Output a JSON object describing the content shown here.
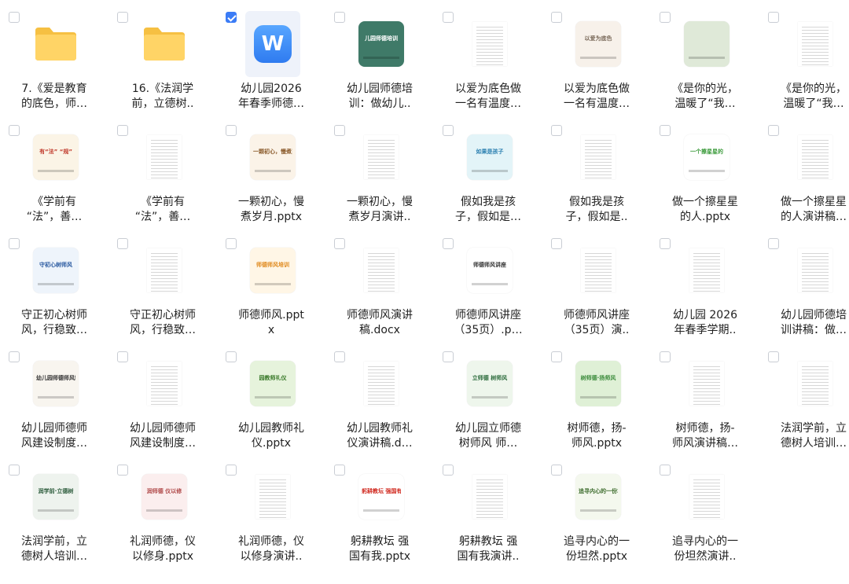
{
  "files": [
    {
      "kind": "folder",
      "line1": "7.《爱是教育",
      "line2": "的底色，师…",
      "selected": false
    },
    {
      "kind": "folder",
      "line1": "16.《法润学",
      "line2": "前，立德树..",
      "selected": false
    },
    {
      "kind": "wps",
      "glyph": "W",
      "line1": "幼儿园2026",
      "line2": "年春季师德…",
      "selected": true
    },
    {
      "kind": "slide",
      "bg": "#3f7a68",
      "fg": "#ffffff",
      "text": "儿园师德培训",
      "line1": "幼儿园师德培",
      "line2": "训：做幼儿..",
      "selected": false
    },
    {
      "kind": "doc",
      "line1": "以爱为底色做",
      "line2": "一名有温度…",
      "selected": false
    },
    {
      "kind": "slide",
      "bg": "#f7f1ea",
      "fg": "#7a6a5a",
      "text": "以爱为底色",
      "line1": "以爱为底色做",
      "line2": "一名有温度…",
      "selected": false
    },
    {
      "kind": "slide",
      "bg": "#dfe9d8",
      "fg": "#4a7a3a",
      "text": "",
      "line1": "《是你的光，",
      "line2": "温暖了“我…",
      "selected": false
    },
    {
      "kind": "doc",
      "line1": "《是你的光，",
      "line2": "温暖了“我…",
      "selected": false
    },
    {
      "kind": "slide",
      "bg": "#fbf4e6",
      "fg": "#c0392b",
      "text": "有“法” “规”",
      "line1": "《学前有",
      "line2": "“法”，善…",
      "selected": false
    },
    {
      "kind": "doc",
      "line1": "《学前有",
      "line2": "“法”，善…",
      "selected": false
    },
    {
      "kind": "slide",
      "bg": "#fbf3e8",
      "fg": "#8a5a2a",
      "text": "一颗初心，慢煮岁月",
      "line1": "一颗初心，慢",
      "line2": "煮岁月.pptx",
      "selected": false
    },
    {
      "kind": "doc",
      "line1": "一颗初心，慢",
      "line2": "煮岁月演讲..",
      "selected": false
    },
    {
      "kind": "slide",
      "bg": "#e3f4f8",
      "fg": "#2a7fb0",
      "text": "如果是孩子",
      "line1": "假如我是孩",
      "line2": "子，假如是…",
      "selected": false
    },
    {
      "kind": "doc",
      "line1": "假如我是孩",
      "line2": "子，假如是..",
      "selected": false
    },
    {
      "kind": "slide",
      "bg": "#ffffff",
      "fg": "#3a9a3a",
      "text": "一个擦星星的",
      "line1": "做一个擦星星",
      "line2": "的人.pptx",
      "selected": false
    },
    {
      "kind": "doc",
      "line1": "做一个擦星星",
      "line2": "的人演讲稿…",
      "selected": false
    },
    {
      "kind": "slide",
      "bg": "#eef4fb",
      "fg": "#2a5aa0",
      "text": "守初心树师风",
      "line1": "守正初心树师",
      "line2": "风，行稳致…",
      "selected": false
    },
    {
      "kind": "doc",
      "line1": "守正初心树师",
      "line2": "风，行稳致…",
      "selected": false
    },
    {
      "kind": "slide",
      "bg": "#fff6e6",
      "fg": "#e08a1e",
      "text": "师德师风培训",
      "line1": "师德师风.ppt",
      "line2": "x",
      "selected": false
    },
    {
      "kind": "doc",
      "line1": "师德师风演讲",
      "line2": "稿.docx",
      "selected": false
    },
    {
      "kind": "slide",
      "bg": "#ffffff",
      "fg": "#333333",
      "text": "师德师风讲座",
      "line1": "师德师风讲座",
      "line2": "（35页）.p…",
      "selected": false
    },
    {
      "kind": "doc",
      "line1": "师德师风讲座",
      "line2": "（35页）演..",
      "selected": false
    },
    {
      "kind": "doc",
      "line1": "幼儿园 2026",
      "line2": "年春季学期..",
      "selected": false
    },
    {
      "kind": "doc",
      "line1": "幼儿园师德培",
      "line2": "训讲稿：做…",
      "selected": false
    },
    {
      "kind": "slide",
      "bg": "#f8f5ef",
      "fg": "#333333",
      "text": "幼儿园师德师风制度",
      "line1": "幼儿园师德师",
      "line2": "风建设制度…",
      "selected": false
    },
    {
      "kind": "doc",
      "line1": "幼儿园师德师",
      "line2": "风建设制度…",
      "selected": false
    },
    {
      "kind": "slide",
      "bg": "#e6f3dc",
      "fg": "#3a7a2a",
      "text": "园教师礼仪",
      "line1": "幼儿园教师礼",
      "line2": "仪.pptx",
      "selected": false
    },
    {
      "kind": "doc",
      "line1": "幼儿园教师礼",
      "line2": "仪演讲稿.d…",
      "selected": false
    },
    {
      "kind": "slide",
      "bg": "#eef6ec",
      "fg": "#2a6a3a",
      "text": "立师德 树师风",
      "line1": "幼儿园立师德",
      "line2": "树师风 师…",
      "selected": false
    },
    {
      "kind": "slide",
      "bg": "#dff0d6",
      "fg": "#3a8a3a",
      "text": "树师德·扬师风",
      "line1": "树师德，扬-",
      "line2": "师风.pptx",
      "selected": false
    },
    {
      "kind": "doc",
      "line1": "树师德，扬-",
      "line2": "师风演讲稿…",
      "selected": false
    },
    {
      "kind": "doc",
      "line1": "法润学前，立",
      "line2": "德树人培训…",
      "selected": false
    },
    {
      "kind": "slide",
      "bg": "#eef3ee",
      "fg": "#2a5a3a",
      "text": "润学前·立德树",
      "line1": "法润学前，立",
      "line2": "德树人培训…",
      "selected": false
    },
    {
      "kind": "slide",
      "bg": "#fbeeee",
      "fg": "#b04a4a",
      "text": "润师德 仪以修",
      "line1": "礼润师德，仪",
      "line2": "以修身.pptx",
      "selected": false
    },
    {
      "kind": "doc",
      "line1": "礼润师德，仪",
      "line2": "以修身演讲..",
      "selected": false
    },
    {
      "kind": "slide",
      "bg": "#ffffff",
      "fg": "#d0281e",
      "text": "躬耕教坛 强国有",
      "line1": "躬耕教坛 强",
      "line2": "国有我.pptx",
      "selected": false
    },
    {
      "kind": "doc",
      "line1": "躬耕教坛 强",
      "line2": "国有我演讲..",
      "selected": false
    },
    {
      "kind": "slide",
      "bg": "#f4f8ee",
      "fg": "#3a6a2a",
      "text": "追寻内心的一份坦然",
      "line1": "追寻内心的一",
      "line2": "份坦然.pptx",
      "selected": false
    },
    {
      "kind": "doc",
      "line1": "追寻内心的一",
      "line2": "份坦然演讲..",
      "selected": false
    }
  ]
}
